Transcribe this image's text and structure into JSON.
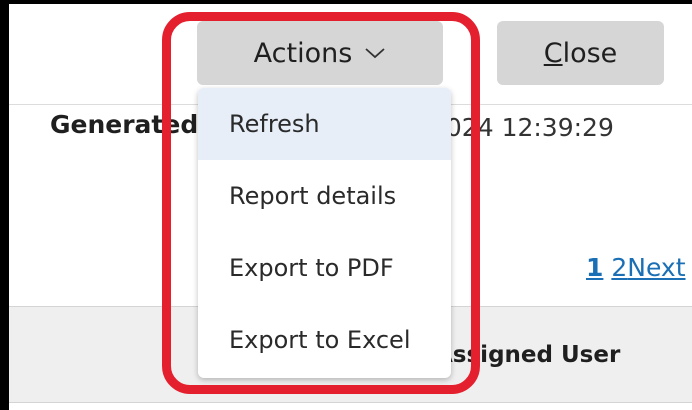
{
  "header": {
    "actions_label": "Actions",
    "close_label_underlined": "C",
    "close_label_rest": "lose"
  },
  "report": {
    "generated_label": "Generated",
    "generated_value": "2024 12:39:29"
  },
  "pagination": {
    "page1": "1",
    "page2": "2",
    "next": "Next"
  },
  "table": {
    "column_assigned_user": "Assigned User"
  },
  "actions_menu": {
    "items": [
      {
        "label": "Refresh"
      },
      {
        "label": "Report details"
      },
      {
        "label": "Export to PDF"
      },
      {
        "label": "Export to Excel"
      }
    ]
  },
  "colors": {
    "highlight": "#e4202e",
    "button_bg": "#d6d6d6",
    "link": "#1a6fb5",
    "menu_hover": "#e7eef8"
  }
}
